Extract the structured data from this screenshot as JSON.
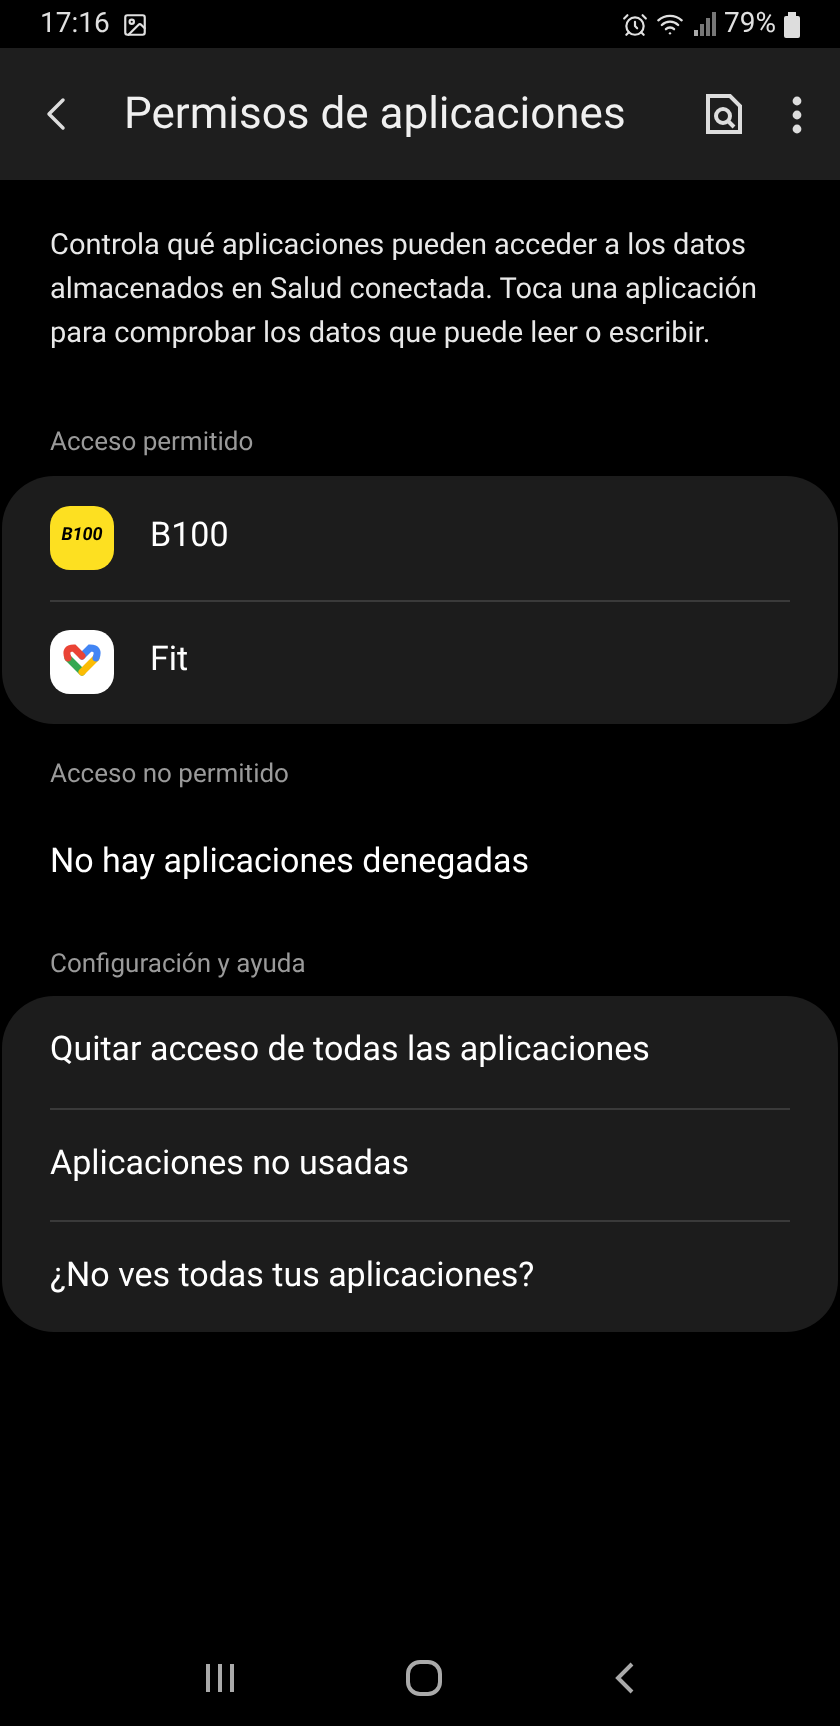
{
  "status_bar": {
    "time": "17:16",
    "battery": "79%"
  },
  "app_bar": {
    "title": "Permisos de aplicaciones"
  },
  "description": "Controla qué aplicaciones pueden acceder a los datos almacenados en Salud conectada. Toca una aplicación para comprobar los datos que puede leer o escribir.",
  "allowed": {
    "header": "Acceso permitido",
    "apps": [
      {
        "name": "B100",
        "kind": "b100",
        "logo_text": "B100"
      },
      {
        "name": "Fit",
        "kind": "fit"
      }
    ]
  },
  "denied": {
    "header": "Acceso no permitido",
    "empty_text": "No hay aplicaciones denegadas"
  },
  "help": {
    "header": "Configuración y ayuda",
    "items": [
      "Quitar acceso de todas las aplicaciones",
      "Aplicaciones no usadas",
      "¿No ves todas tus aplicaciones?"
    ]
  }
}
